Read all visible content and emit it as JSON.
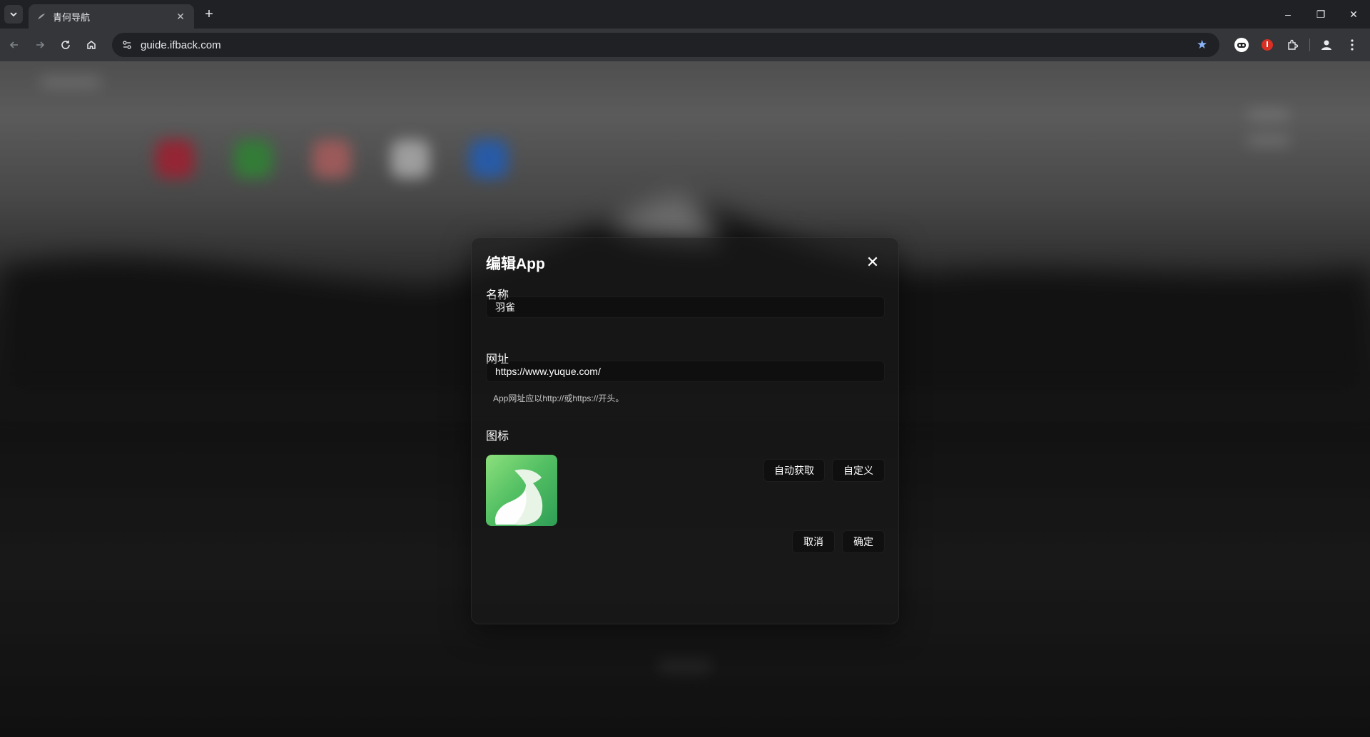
{
  "browser": {
    "tab": {
      "title": "青何导航",
      "close_icon": "close-icon"
    },
    "new_tab_label": "+",
    "url": "guide.ifback.com",
    "window_controls": {
      "minimize": "–",
      "restore": "❐",
      "close": "✕"
    }
  },
  "dialog": {
    "title": "编辑App",
    "name_label": "名称",
    "name_value": "羽雀",
    "url_label": "网址",
    "url_value": "https://www.yuque.com/",
    "url_hint": "App网址应以http://或https://开头。",
    "icon_label": "图标",
    "auto_fetch_label": "自动获取",
    "custom_label": "自定义",
    "cancel_label": "取消",
    "confirm_label": "确定"
  },
  "colors": {
    "accent_star": "#8ab4f8",
    "app_icon_green": "#55c164",
    "background_app_colors": [
      "#e53950",
      "#4fbf55",
      "#f08a8a",
      "#f2f2f2",
      "#3d8bff"
    ]
  }
}
